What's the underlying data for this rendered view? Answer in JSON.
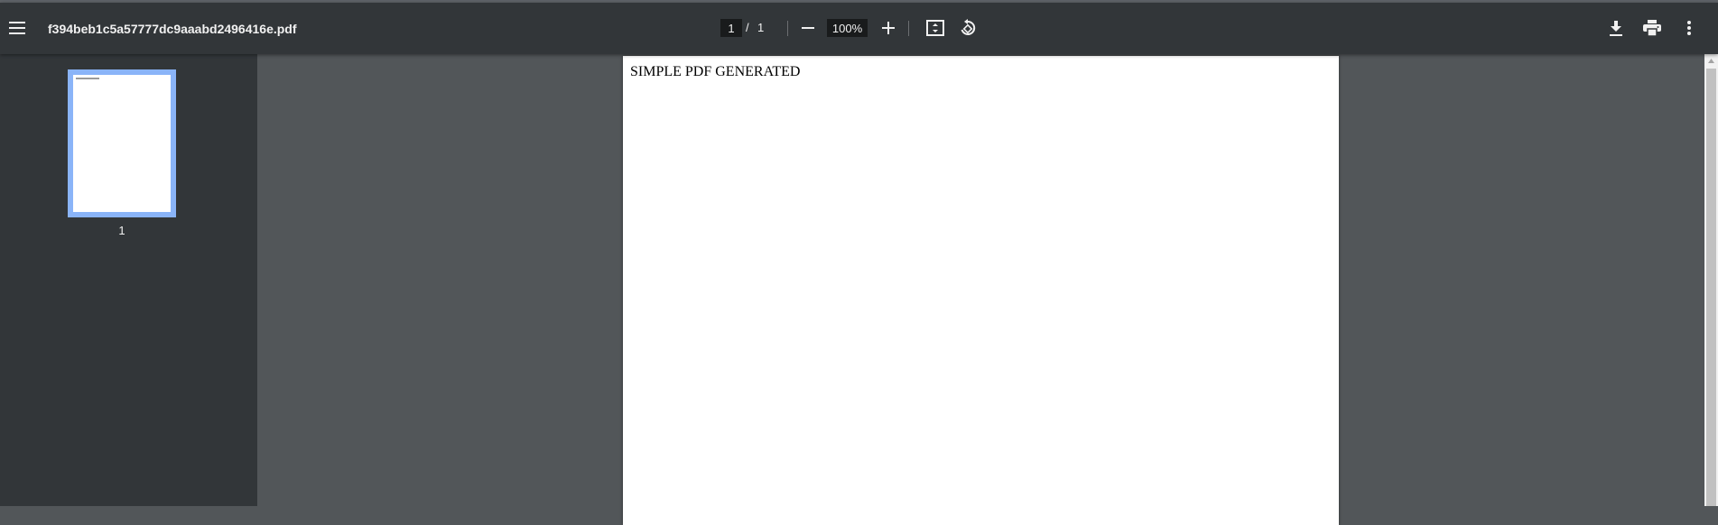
{
  "toolbar": {
    "title": "f394beb1c5a57777dc9aaabd2496416e.pdf",
    "current_page": "1",
    "page_separator": "/",
    "total_pages": "1",
    "zoom": "100%",
    "icons": {
      "menu": "menu-icon",
      "zoom_out": "minus-icon",
      "zoom_in": "plus-icon",
      "fit": "fit-to-page-icon",
      "rotate": "rotate-counterclockwise-icon",
      "download": "download-icon",
      "print": "print-icon",
      "more": "more-vert-icon"
    }
  },
  "sidebar": {
    "thumbnails": [
      {
        "page_number": "1",
        "selected": true
      }
    ],
    "selection_color": "#8ab4f8"
  },
  "document": {
    "text": "SIMPLE PDF GENERATED"
  },
  "colors": {
    "toolbar_bg": "#323639",
    "viewer_bg": "#525659",
    "field_bg": "#191b1c"
  }
}
